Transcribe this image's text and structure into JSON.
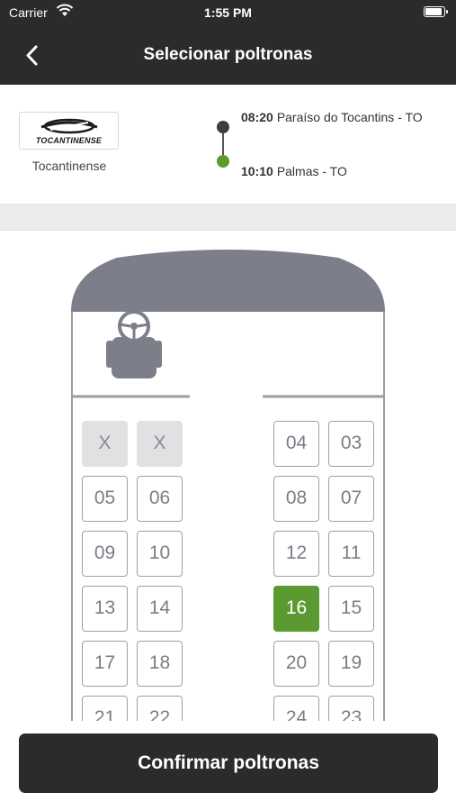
{
  "status_bar": {
    "carrier": "Carrier",
    "time": "1:55 PM",
    "battery_level": 0.95
  },
  "nav": {
    "back_icon": "chevron-left-icon",
    "title": "Selecionar poltronas"
  },
  "trip": {
    "logo_text": "TOCANTINENSE",
    "company": "Tocantinense",
    "departure": {
      "time": "08:20",
      "place": "Paraíso do Tocantins - TO"
    },
    "arrival": {
      "time": "10:10",
      "place": "Palmas - TO"
    }
  },
  "colors": {
    "header": "#2b2b2b",
    "selected_seat": "#5b9a30",
    "blocked_seat": "#e1e1e3",
    "seat_border": "#9fa0a8"
  },
  "seats": {
    "left": [
      [
        {
          "label": "X",
          "state": "blocked"
        },
        {
          "label": "X",
          "state": "blocked"
        }
      ],
      [
        {
          "label": "05",
          "state": "available"
        },
        {
          "label": "06",
          "state": "available"
        }
      ],
      [
        {
          "label": "09",
          "state": "available"
        },
        {
          "label": "10",
          "state": "available"
        }
      ],
      [
        {
          "label": "13",
          "state": "available"
        },
        {
          "label": "14",
          "state": "available"
        }
      ],
      [
        {
          "label": "17",
          "state": "available"
        },
        {
          "label": "18",
          "state": "available"
        }
      ],
      [
        {
          "label": "21",
          "state": "available"
        },
        {
          "label": "22",
          "state": "available"
        }
      ]
    ],
    "right": [
      [
        {
          "label": "04",
          "state": "available"
        },
        {
          "label": "03",
          "state": "available"
        }
      ],
      [
        {
          "label": "08",
          "state": "available"
        },
        {
          "label": "07",
          "state": "available"
        }
      ],
      [
        {
          "label": "12",
          "state": "available"
        },
        {
          "label": "11",
          "state": "available"
        }
      ],
      [
        {
          "label": "16",
          "state": "selected"
        },
        {
          "label": "15",
          "state": "available"
        }
      ],
      [
        {
          "label": "20",
          "state": "available"
        },
        {
          "label": "19",
          "state": "available"
        }
      ],
      [
        {
          "label": "24",
          "state": "available"
        },
        {
          "label": "23",
          "state": "available"
        }
      ]
    ]
  },
  "confirm_button": "Confirmar poltronas"
}
